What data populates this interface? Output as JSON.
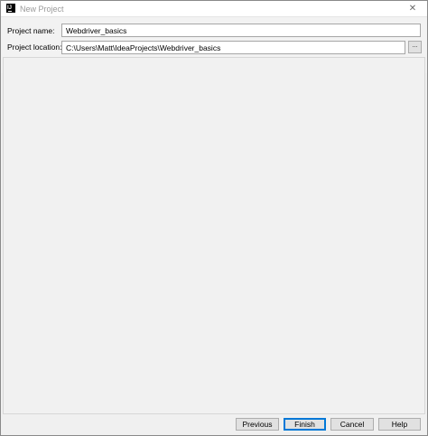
{
  "window": {
    "title": "New Project",
    "close_glyph": "✕",
    "icon": "intellij-icon",
    "icon_text": "IJ"
  },
  "form": {
    "project_name_label": "Project name:",
    "project_name_value": "Webdriver_basics",
    "project_location_label": "Project location:",
    "project_location_value": "C:\\Users\\Matt\\IdeaProjects\\Webdriver_basics",
    "browse_label": "..."
  },
  "footer": {
    "previous_label": "Previous",
    "finish_label": "Finish",
    "cancel_label": "Cancel",
    "help_label": "Help"
  },
  "colors": {
    "accent": "#0078d7",
    "background": "#f0f0f0"
  }
}
